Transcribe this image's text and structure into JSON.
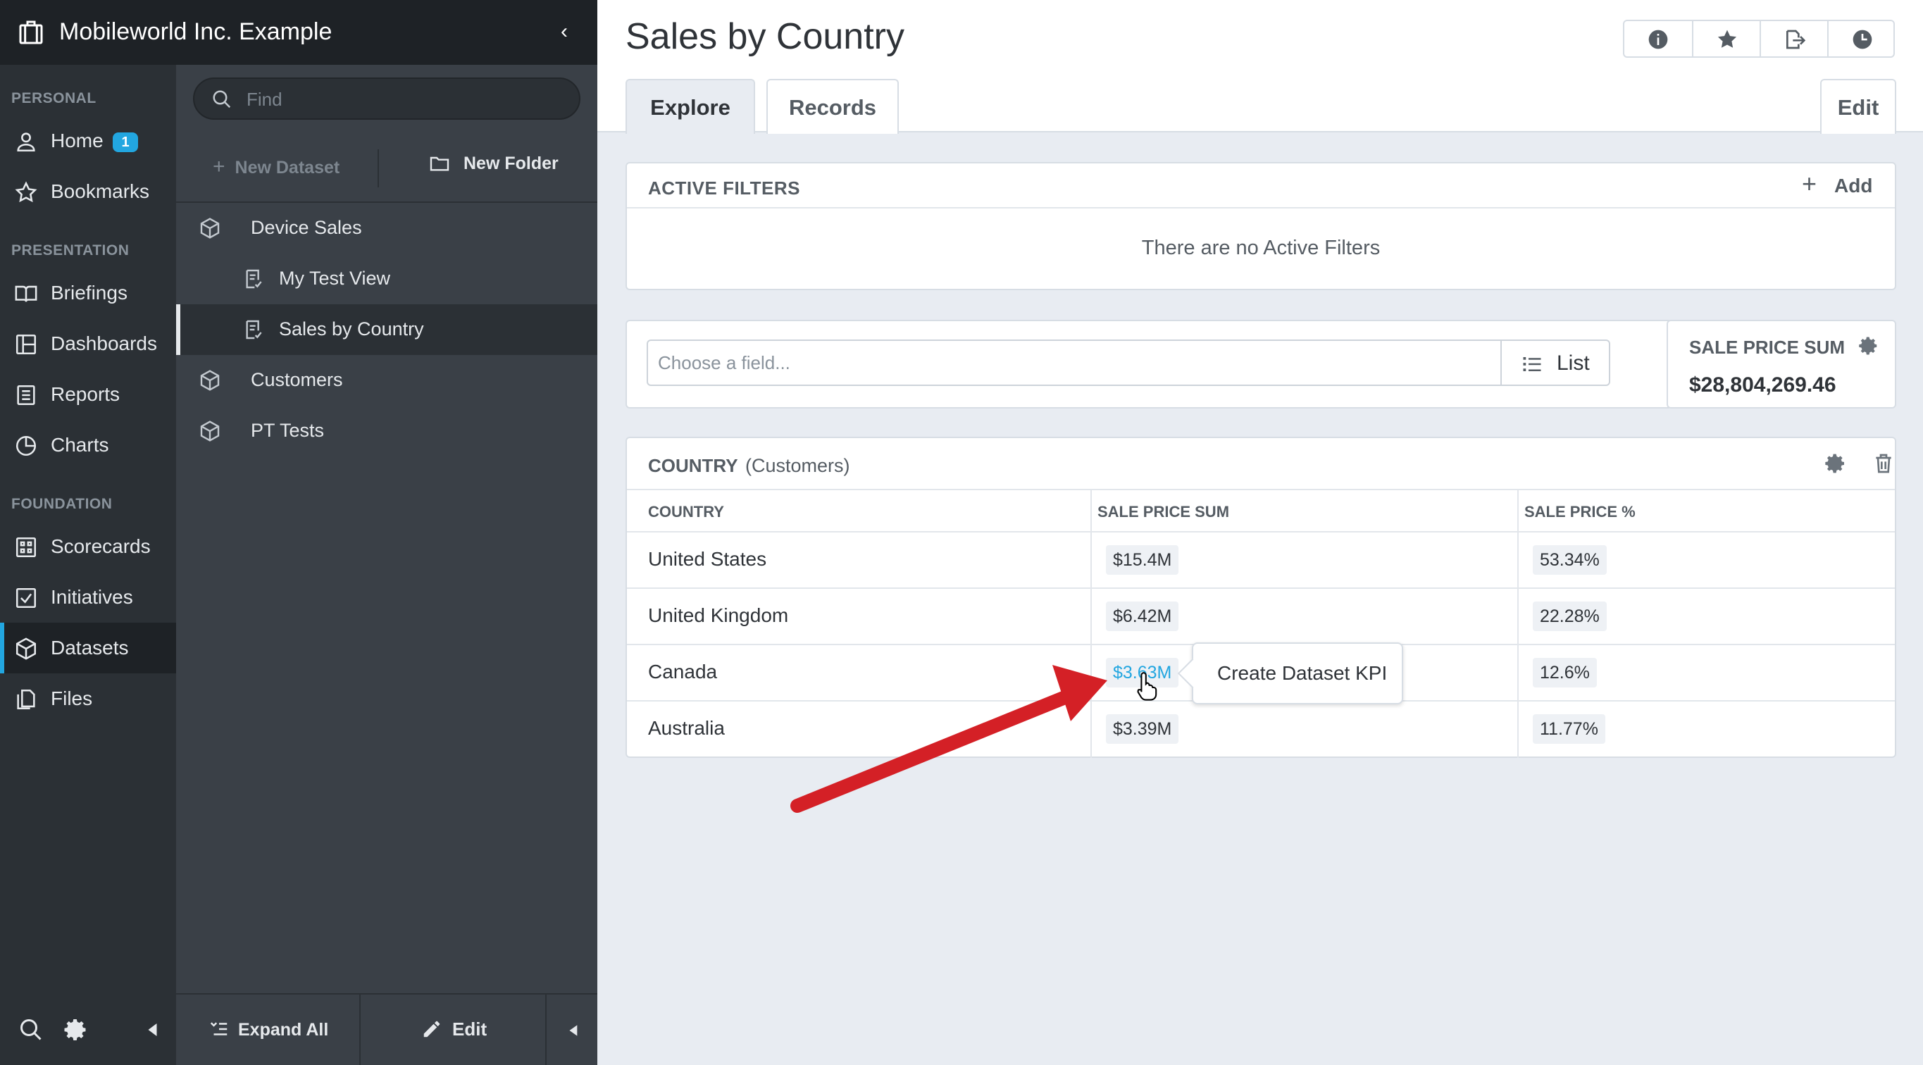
{
  "app": {
    "org_name": "Mobileworld Inc. Example"
  },
  "nav": {
    "sections": {
      "personal": "PERSONAL",
      "presentation": "PRESENTATION",
      "foundation": "FOUNDATION"
    },
    "items": {
      "home": {
        "label": "Home",
        "badge": "1"
      },
      "bookmarks": {
        "label": "Bookmarks"
      },
      "briefings": {
        "label": "Briefings"
      },
      "dashboards": {
        "label": "Dashboards"
      },
      "reports": {
        "label": "Reports"
      },
      "charts": {
        "label": "Charts"
      },
      "scorecards": {
        "label": "Scorecards"
      },
      "initiatives": {
        "label": "Initiatives"
      },
      "datasets": {
        "label": "Datasets"
      },
      "files": {
        "label": "Files"
      }
    }
  },
  "tree": {
    "search_placeholder": "Find",
    "new_dataset_label": "New Dataset",
    "new_folder_label": "New Folder",
    "items": {
      "device_sales": "Device Sales",
      "my_test_view": "My Test View",
      "sales_by_country": "Sales by Country",
      "customers": "Customers",
      "pt_tests": "PT Tests"
    },
    "expand_all_label": "Expand All",
    "edit_label": "Edit"
  },
  "page": {
    "title": "Sales by Country",
    "tabs": {
      "explore": "Explore",
      "records": "Records"
    },
    "edit_label": "Edit"
  },
  "filters": {
    "title": "ACTIVE FILTERS",
    "add_label": "Add",
    "empty_message": "There are no Active Filters"
  },
  "field_chooser": {
    "placeholder": "Choose a field...",
    "list_label": "List"
  },
  "kpi": {
    "label": "SALE PRICE SUM",
    "value": "$28,804,269.46"
  },
  "table": {
    "title": "COUNTRY",
    "subtitle": "(Customers)",
    "columns": {
      "country": "COUNTRY",
      "sum": "SALE PRICE SUM",
      "pct": "SALE PRICE %"
    },
    "rows": [
      {
        "country": "United States",
        "sum": "$15.4M",
        "pct": "53.34%"
      },
      {
        "country": "United Kingdom",
        "sum": "$6.42M",
        "pct": "22.28%"
      },
      {
        "country": "Canada",
        "sum": "$3.63M",
        "pct": "12.6%"
      },
      {
        "country": "Australia",
        "sum": "$3.39M",
        "pct": "11.77%"
      }
    ]
  },
  "tooltip": {
    "label": "Create Dataset KPI"
  },
  "colors": {
    "accent": "#22a6e0",
    "nav_bg": "#2b3035",
    "tree_bg": "#3a4047",
    "annotation_arrow": "#d42026"
  },
  "icons": {
    "brand": "building-icon",
    "collapse": "chevron-left-icon",
    "info": "info-icon",
    "bookmark": "star-icon",
    "export": "export-icon",
    "history": "clock-icon"
  }
}
